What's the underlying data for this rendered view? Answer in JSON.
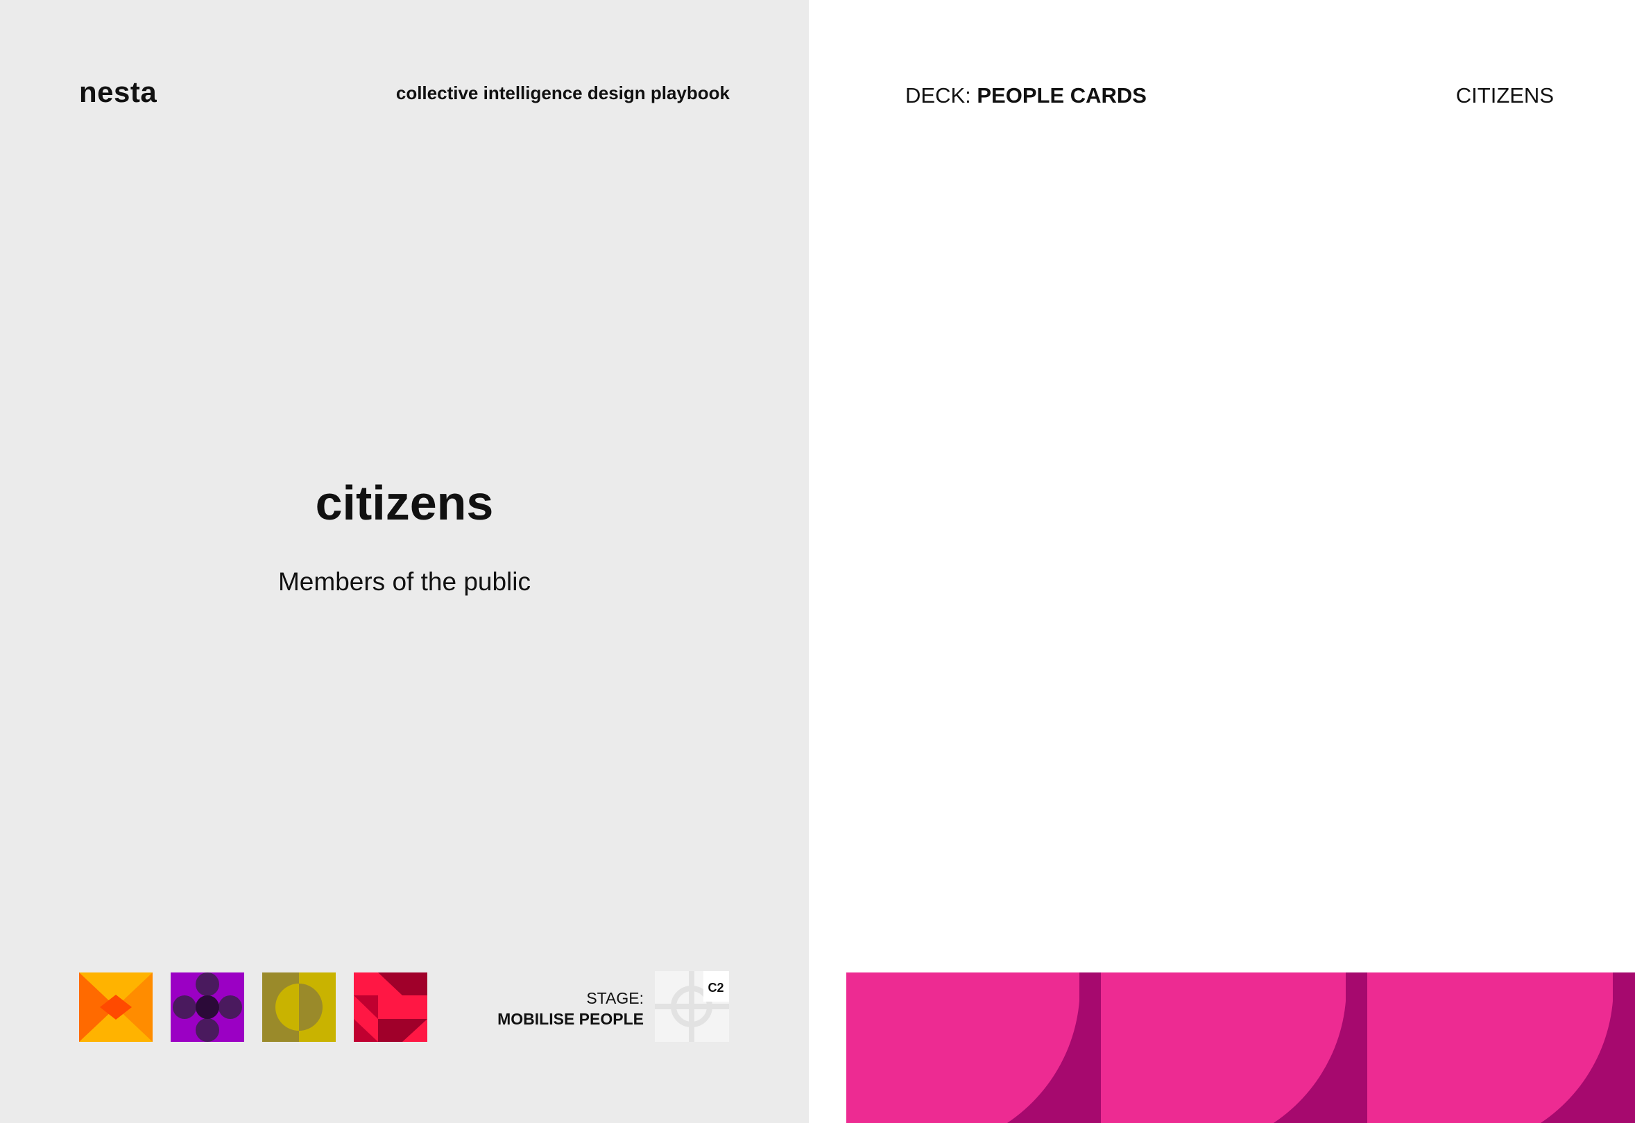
{
  "left_card": {
    "brand": "nesta",
    "playbook_title": "collective intelligence design playbook",
    "title": "citizens",
    "subtitle": "Members of the public",
    "icons": [
      "orange-bowtie-icon",
      "purple-circles-icon",
      "olive-half-circle-icon",
      "red-triangles-icon"
    ],
    "stage": {
      "label": "STAGE:",
      "value": "MOBILISE PEOPLE",
      "code": "C2",
      "icon": "crosshair-icon"
    }
  },
  "right_card": {
    "deck_prefix": "DECK: ",
    "deck_name": "PEOPLE CARDS",
    "card_name": "CITIZENS",
    "pattern": "quarter-circle-pattern"
  },
  "colors": {
    "left_background": "#ebebeb",
    "right_background": "#ffffff",
    "magenta": "#ed2b92",
    "dark_magenta": "#a6096e"
  }
}
